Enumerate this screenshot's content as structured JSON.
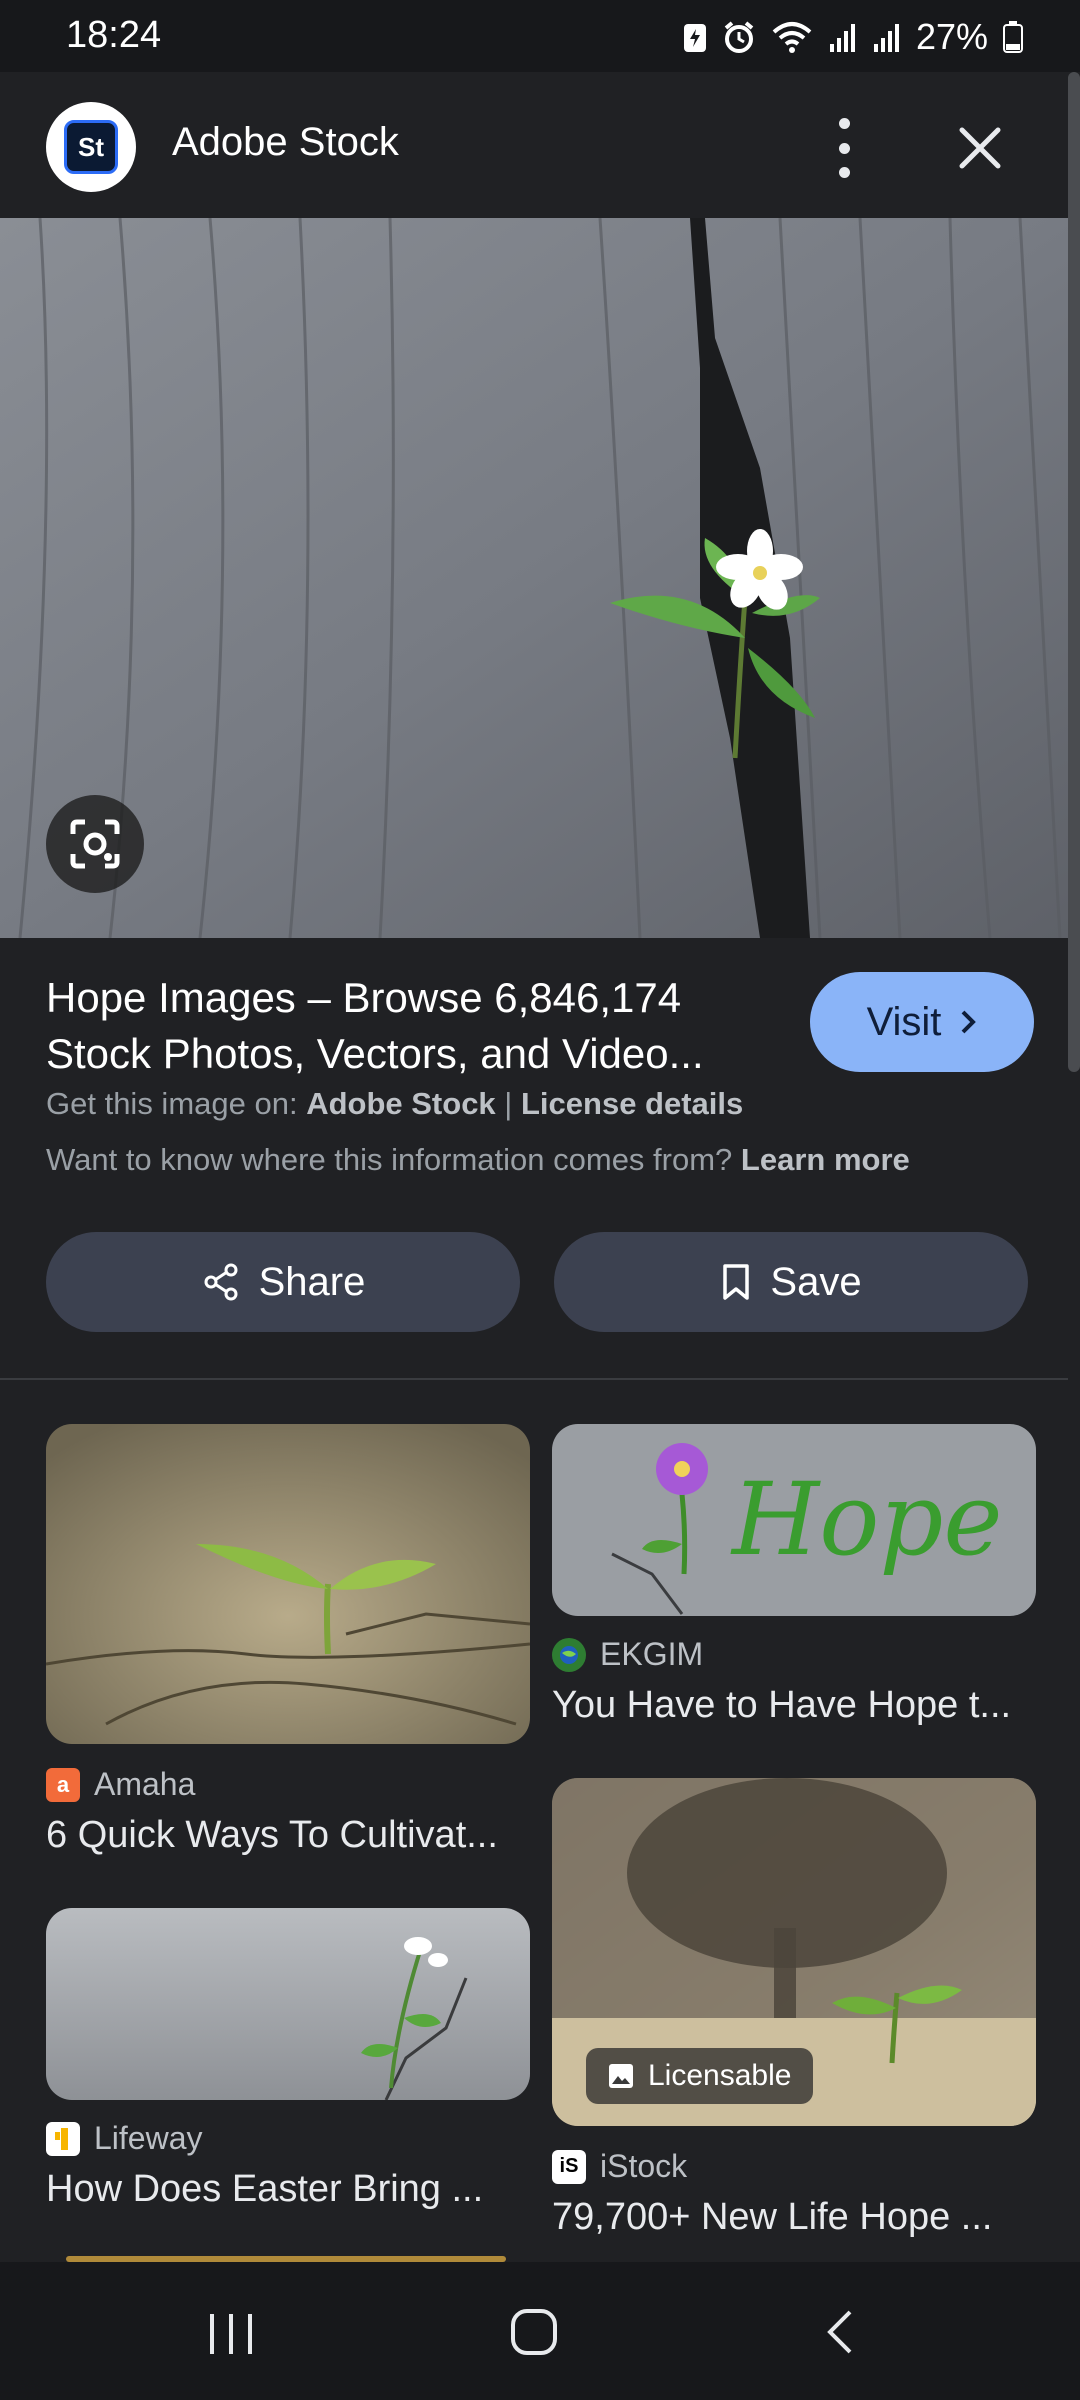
{
  "status_bar": {
    "time": "18:24",
    "battery": "27%",
    "icons": [
      "battery-saver-icon",
      "alarm-icon",
      "wifi-icon",
      "signal-icon",
      "signal-icon",
      "battery-icon"
    ]
  },
  "header": {
    "site_logo_text": "St",
    "site_name": "Adobe Stock",
    "more_icon": "more-vert-icon",
    "close_icon": "close-icon"
  },
  "image_viewer": {
    "lens_icon": "google-lens-icon",
    "title": "Hope Images – Browse 6,846,174 Stock Photos, Vectors, and Video...",
    "visit_label": "Visit",
    "source_prefix": "Get this image on:",
    "source_name": "Adobe Stock",
    "source_separator": "|",
    "license_label": "License details",
    "info_text": "Want to know where this information comes from?",
    "learn_more": "Learn more",
    "share_label": "Share",
    "save_label": "Save"
  },
  "related_results": [
    {
      "site": "Amaha",
      "favicon_text": "a",
      "favicon_color": "#f26b3a",
      "title": "6 Quick Ways To Cultivat..."
    },
    {
      "site": "EKGIM",
      "favicon_text": "",
      "favicon_color": "#2e7d32",
      "title": "You Have to Have Hope t...",
      "thumb_text": "Hope"
    },
    {
      "site": "Lifeway",
      "favicon_text": "",
      "favicon_color": "#f7b500",
      "title": "How Does Easter Bring ..."
    },
    {
      "site": "iStock",
      "favicon_text": "iS",
      "favicon_color": "#000000",
      "title": "79,700+ New Life Hope ...",
      "badge": "Licensable"
    }
  ],
  "colors": {
    "background": "#202124",
    "accent_button": "#8ab4f8",
    "pill_button": "#3c4150"
  }
}
